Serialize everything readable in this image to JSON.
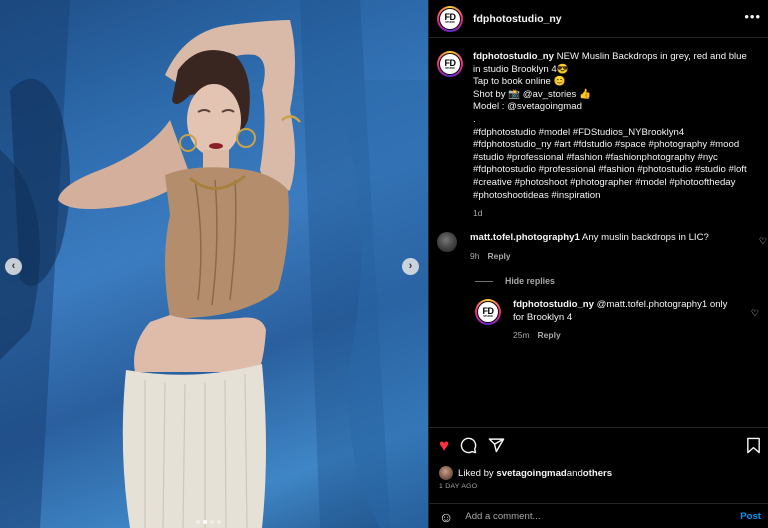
{
  "post": {
    "username": "fdphotostudio_ny",
    "avatar_text": "FD",
    "avatar_subtext": "STUDIO",
    "more_label": "•••"
  },
  "caption": {
    "username": "fdphotostudio_ny",
    "lines": [
      " NEW Muslin Backdrops in grey, red and blue in studio Brooklyn 4😎",
      "Tap to book online 😊",
      "Shot by 📸  @av_stories 👍",
      "Model : @svetagoingmad",
      ".",
      "#fdphotostudio #model #FDStudios_NYBrooklyn4 #fdphotostudio_ny #art #fdstudio #space #photography #mood #studio #professional #fashion #fashionphotography #nyc #fdphotostudio #professional #fashion #photostudio #studio #loft #creative #photoshoot #photographer #model #photooftheday #photoshootideas  #inspiration"
    ],
    "time": "1d"
  },
  "comments": [
    {
      "username": "matt.tofel.photography1",
      "text": " Any muslin backdrops in LIC?",
      "time": "9h",
      "reply_label": "Reply"
    }
  ],
  "hide_replies_label": "Hide replies",
  "replies": [
    {
      "username": "fdphotostudio_ny",
      "text": " @matt.tofel.photography1 only for Brooklyn 4",
      "time": "25m",
      "reply_label": "Reply"
    }
  ],
  "actions": {
    "liked_by_prefix": "Liked by ",
    "liked_by_user": "svetagoingmad",
    "liked_by_and": " and ",
    "liked_by_others": "others",
    "time_ago": "1 DAY AGO",
    "comment_placeholder": "Add a comment...",
    "post_label": "Post"
  },
  "icons": {
    "like": "heart-filled-icon",
    "comment": "comment-icon",
    "share": "share-icon",
    "save": "bookmark-icon",
    "emoji": "emoji-icon",
    "prev": "chevron-left-icon",
    "next": "chevron-right-icon"
  },
  "colors": {
    "like": "#ff3040",
    "post": "#0095f6",
    "backdrop": "#2e6cae"
  },
  "carousel": {
    "slides": 4,
    "active": 2
  }
}
